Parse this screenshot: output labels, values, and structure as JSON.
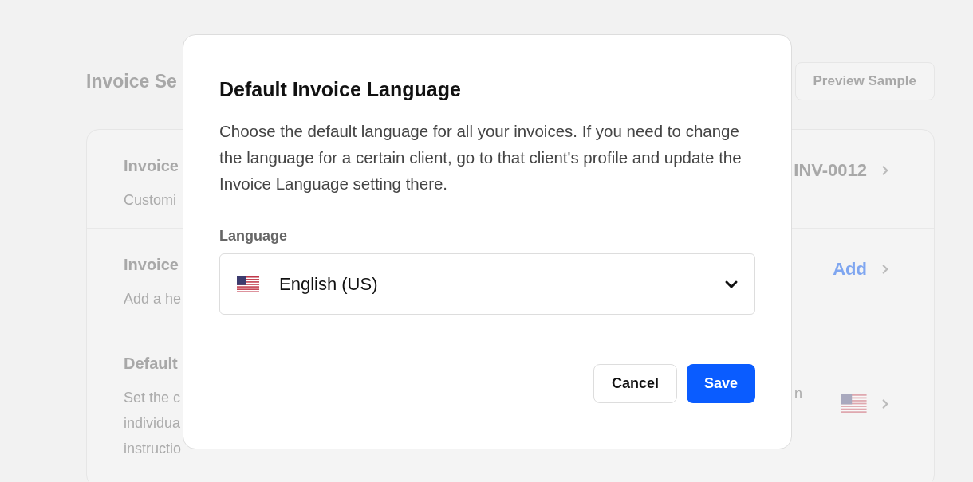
{
  "page": {
    "title": "Invoice Se",
    "preview_button": "Preview Sample"
  },
  "settings": [
    {
      "title": "Invoice",
      "description_lines": [
        "Customi"
      ],
      "kind": "value",
      "value": "INV-0012"
    },
    {
      "title": "Invoice",
      "description_lines": [
        "Add a he"
      ],
      "kind": "link",
      "value": "Add"
    },
    {
      "title": "Default",
      "description_lines": [
        "Set the c",
        "individua",
        "instructio"
      ],
      "kind": "flag",
      "tail": "n"
    }
  ],
  "dialog": {
    "title": "Default Invoice Language",
    "description": "Choose the default language for all your invoices. If you need to change the language for a certain client, go to that client's profile and update the Invoice Language setting there.",
    "field_label": "Language",
    "selected_language": "English (US)",
    "buttons": [
      {
        "label": "Cancel",
        "kind": "secondary"
      },
      {
        "label": "Save",
        "kind": "primary"
      }
    ]
  }
}
